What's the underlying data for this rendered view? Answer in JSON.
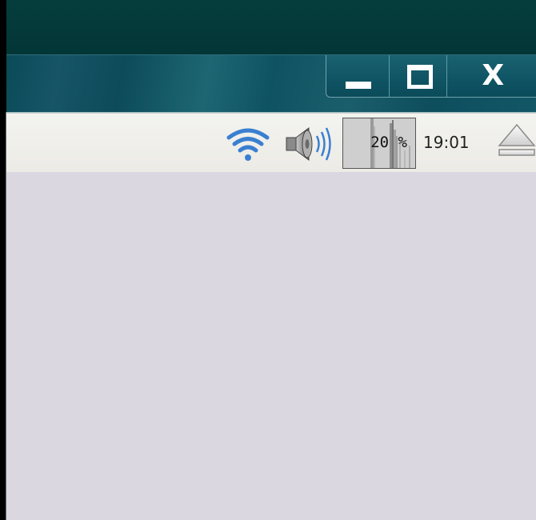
{
  "window_controls": {
    "minimize": "minimize",
    "maximize": "maximize",
    "close_label": "X"
  },
  "panel": {
    "wifi_icon": "wifi-icon",
    "volume_icon": "volume-speaker-icon",
    "cpu_usage_text": "20 %",
    "cpu_usage_percent": 20,
    "clock": "19:01",
    "eject_icon": "eject-icon"
  },
  "colors": {
    "title_bar": "#0f5363",
    "top_strip": "#053d3d",
    "panel_bg": "#ecebe6",
    "desktop_bg": "#dad7e1",
    "wifi_blue": "#3a7fd0"
  }
}
